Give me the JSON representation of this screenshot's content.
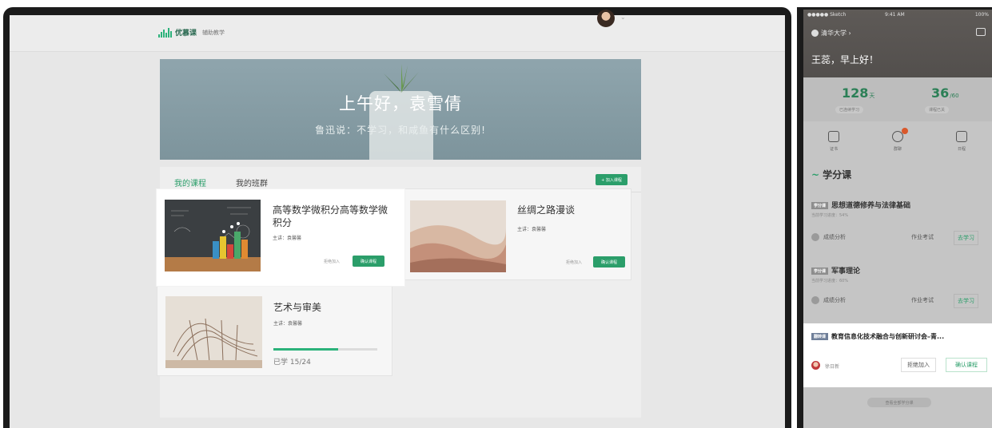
{
  "desktop": {
    "logo_name": "优慕课",
    "logo_sub": "辅助教学",
    "banner_title": "上午好，袁雪倩",
    "banner_sub": "鲁迅说：不学习，和咸鱼有什么区别!",
    "tabs": [
      {
        "label": "我的课程"
      },
      {
        "label": "我的班群"
      }
    ],
    "add_course_label": "+ 加入课程",
    "courses": [
      {
        "title": "高等数学微积分高等数学微积分",
        "teacher": "主讲：袁馨馨",
        "decline": "拒绝加入",
        "confirm": "确认课程"
      },
      {
        "title": "丝绸之路漫谈",
        "teacher": "主讲：袁馨馨",
        "decline": "拒绝加入",
        "confirm": "确认课程"
      },
      {
        "title": "艺术与审美",
        "teacher": "主讲：袁馨馨",
        "progress_text": "已学 15/24",
        "progress": 0.625
      }
    ]
  },
  "phone": {
    "status": {
      "signal": "●●●●● Sketch ",
      "time": "9:41 AM",
      "battery": "100%"
    },
    "school": "清华大学 ›",
    "greeting": "王蕊，早上好！",
    "stats": [
      {
        "value": "128",
        "unit": "天",
        "label": "已连续学习"
      },
      {
        "value": "36",
        "unit": "/60",
        "label": "课程已关"
      }
    ],
    "quick_actions": [
      {
        "label": "证书"
      },
      {
        "label": "群聊"
      },
      {
        "label": "日程"
      }
    ],
    "section_title": "学分课",
    "courses": [
      {
        "tag": "学分课",
        "name": "思想道德修养与法律基础",
        "progress": "当前学习进度：54%",
        "grade": "成绩分析",
        "exam": "作业考试",
        "study": "去学习"
      },
      {
        "tag": "学分课",
        "name": "军事理论",
        "progress": "当前学习进度：60%",
        "grade": "成绩分析",
        "exam": "作业考试",
        "study": "去学习"
      }
    ],
    "invite": {
      "tag": "翻转课",
      "title": "教育信息化技术融合与创新研讨会–青...",
      "teacher": "徐日新",
      "decline": "拒绝加入",
      "confirm": "确认课程"
    },
    "view_all": "查看全部学分课"
  },
  "colors": {
    "accent": "#2b9e6a",
    "banner": "#8fa5ad"
  }
}
